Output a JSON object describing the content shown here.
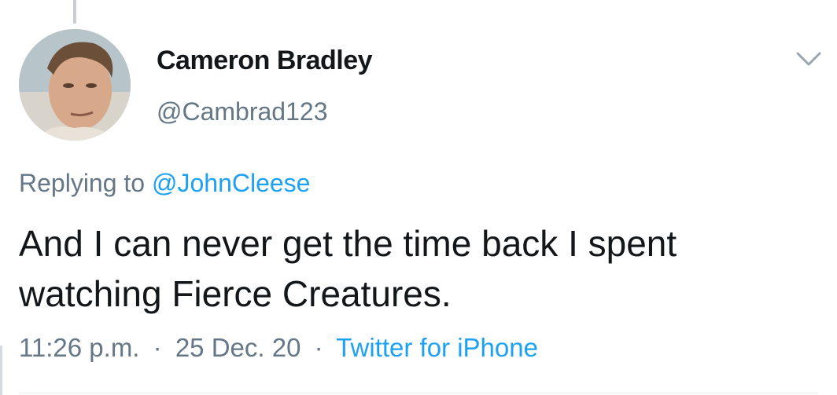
{
  "author": {
    "name": "Cameron Bradley",
    "handle": "@Cambrad123"
  },
  "reply": {
    "prefix": "Replying to",
    "mention": "@JohnCleese"
  },
  "tweet": {
    "text": "And I can never get the time back I spent watching Fierce Creatures."
  },
  "meta": {
    "time": "11:26 p.m.",
    "date": "25 Dec. 20",
    "source": "Twitter for iPhone",
    "separator": "·"
  },
  "icons": {
    "menu": "chevron-down-icon"
  },
  "colors": {
    "text_primary": "#14171a",
    "text_secondary": "#657786",
    "link": "#1da1f2"
  }
}
